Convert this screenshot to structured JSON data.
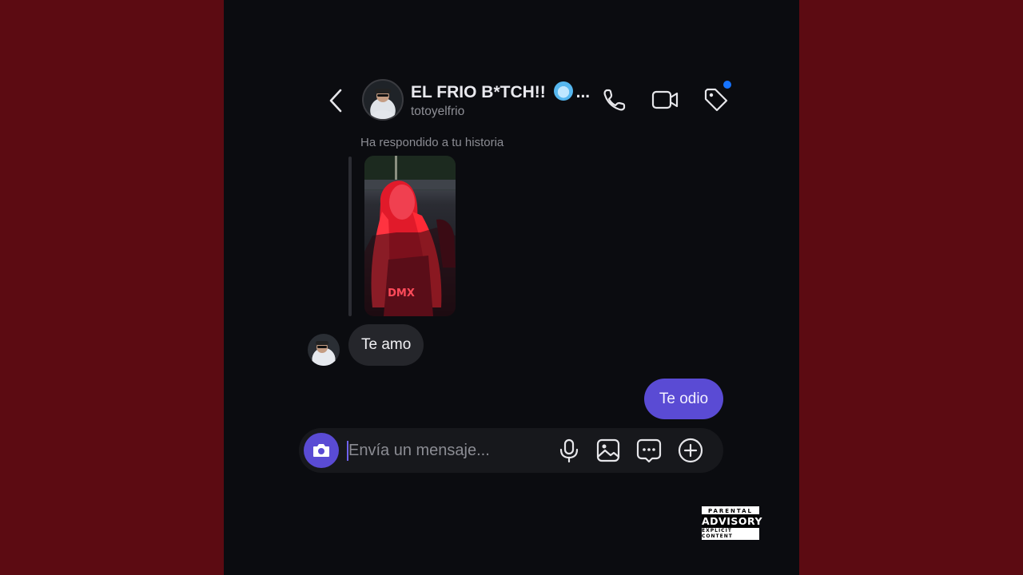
{
  "colors": {
    "side_background": "#5c0b12",
    "panel_background": "#0b0c10",
    "accent": "#5a4bd4",
    "incoming_bubble": "#25262b",
    "notification_dot": "#1673ff"
  },
  "header": {
    "back_icon": "chevron-left-icon",
    "title": "EL FRIO B*TCH!! ",
    "title_emoji": "freezing-face-emoji",
    "title_ellipsis": "...",
    "username": "totoyelfrio",
    "icons": [
      "phone-icon",
      "video-camera-icon",
      "tag-icon"
    ]
  },
  "conversation": {
    "reply_note": "Ha respondido a tu historia",
    "story_caption": "DMX",
    "incoming_message": "Te amo",
    "outgoing_message": "Te odio"
  },
  "composer": {
    "placeholder": "Envía un mensaje...",
    "icons": [
      "camera-icon",
      "microphone-icon",
      "image-icon",
      "chat-bubble-icon",
      "plus-circle-icon"
    ]
  },
  "advisory": {
    "line1": "PARENTAL",
    "line2": "ADVISORY",
    "line3": "EXPLICIT CONTENT"
  }
}
